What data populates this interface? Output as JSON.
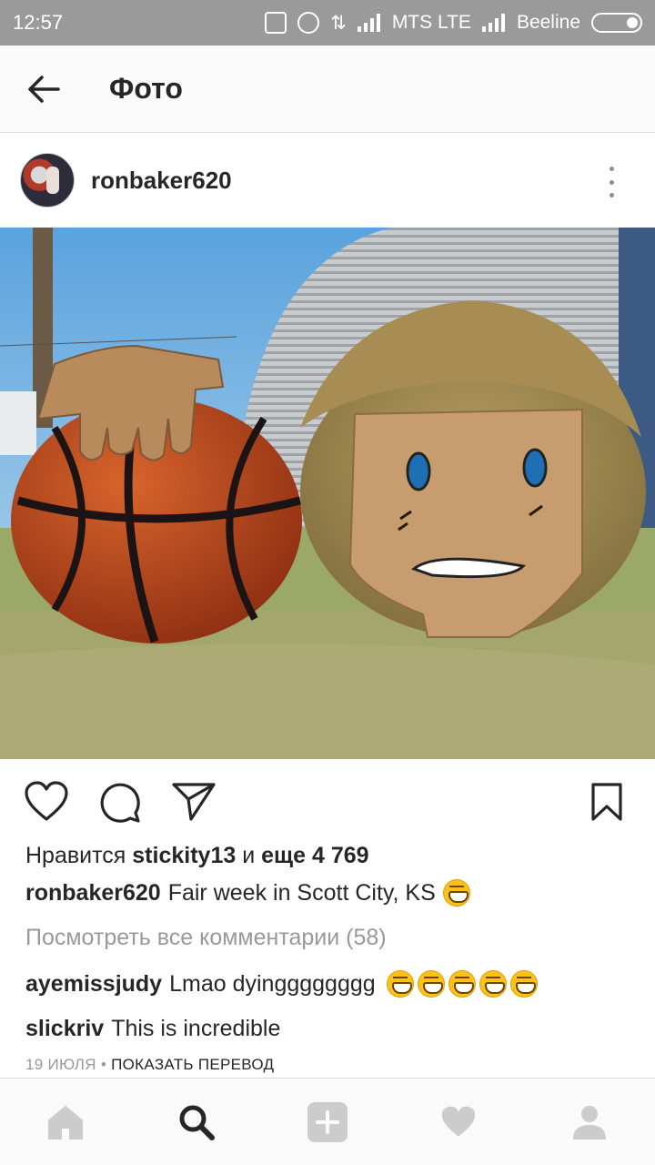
{
  "status_bar": {
    "time": "12:57",
    "carrier1": "MTS LTE",
    "carrier2": "Beeline",
    "icons": [
      "mute-icon",
      "alarm-icon",
      "data-arrows-icon",
      "signal-icon",
      "signal-icon",
      "battery-icon"
    ]
  },
  "header": {
    "title": "Фото",
    "back_icon": "arrow-left-icon"
  },
  "post": {
    "username": "ronbaker620",
    "photo_alt": "photo",
    "likes": {
      "prefix": "Нравится",
      "user": "stickity13",
      "joiner": "и",
      "count_text": "еще 4 769"
    },
    "caption": {
      "username": "ronbaker620",
      "text": "Fair week in Scott City, KS",
      "emoji_count": 1
    },
    "view_comments": "Посмотреть все комментарии (58)",
    "comments": [
      {
        "username": "ayemissjudy",
        "text": "Lmao dyingggggggg",
        "emoji_count": 5
      },
      {
        "username": "slickriv",
        "text": "This is incredible",
        "emoji_count": 0
      }
    ],
    "date": "19 ИЮЛЯ",
    "separator": "•",
    "translate_label": "ПОКАЗАТЬ ПЕРЕВОД"
  },
  "actions": [
    "heart-icon",
    "comment-icon",
    "share-icon",
    "bookmark-icon"
  ],
  "bottom_nav": [
    "home-icon",
    "search-icon",
    "add-icon",
    "heart-icon",
    "profile-icon"
  ],
  "colors": {
    "text": "#262626",
    "muted": "#999999",
    "border": "#dbdbdb",
    "nav_icon": "#cccccc"
  }
}
